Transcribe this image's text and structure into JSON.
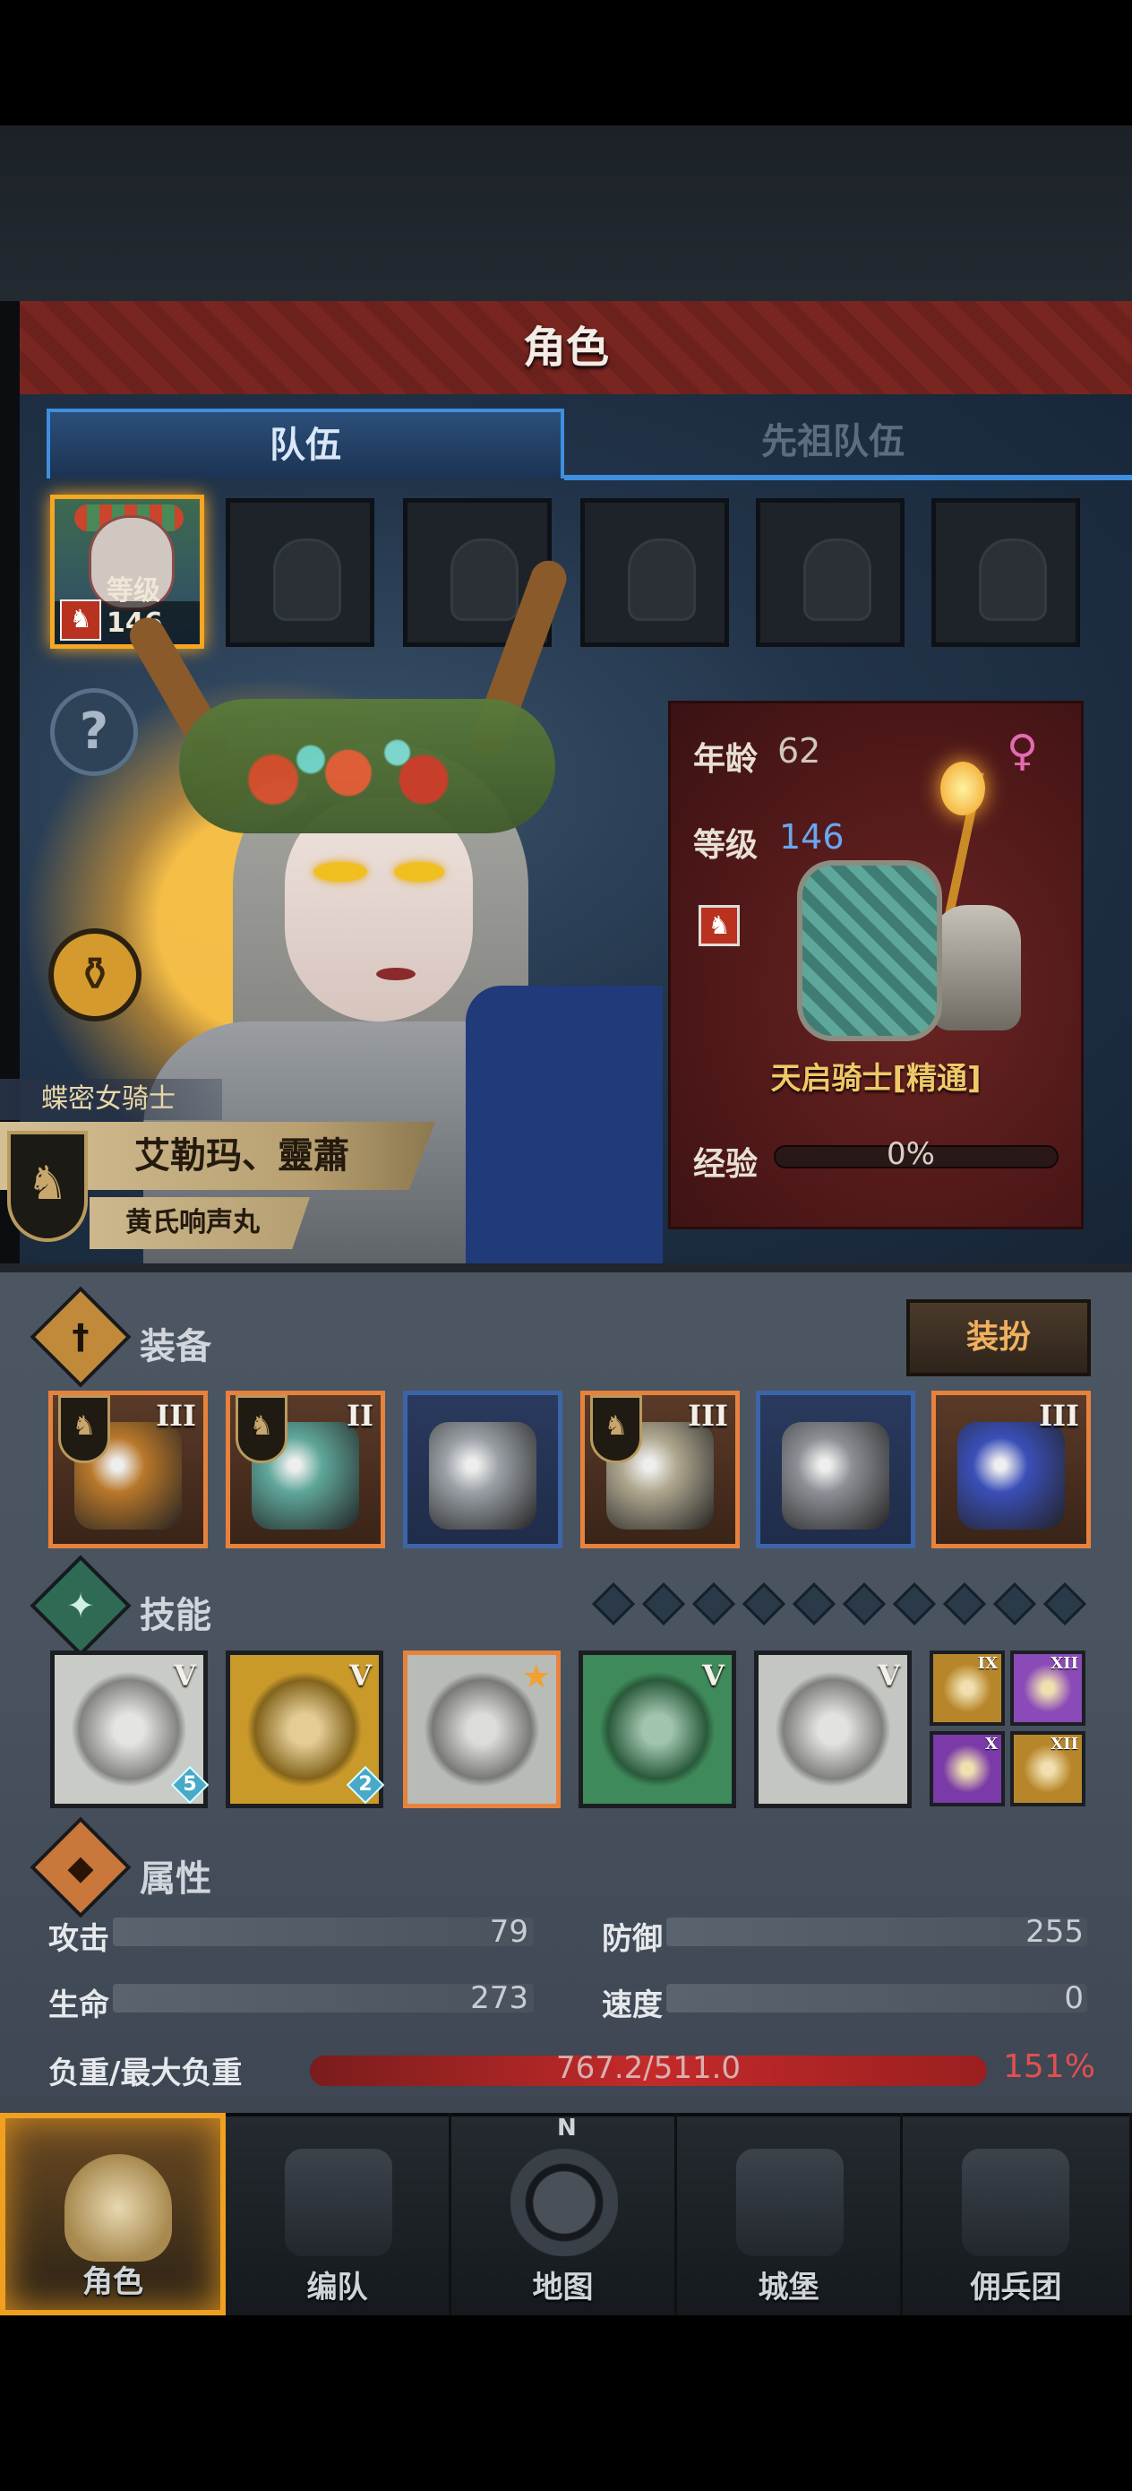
{
  "header": {
    "title": "角色"
  },
  "tabs": [
    {
      "label": "队伍",
      "active": true
    },
    {
      "label": "先祖队伍",
      "active": false
    }
  ],
  "party_slot": {
    "level_text": "等级146",
    "class_symbol": "♞"
  },
  "help_symbol": "?",
  "potion_symbol": "⚱",
  "character": {
    "class_title": "蝶密女骑士",
    "name": "艾勒玛、靈蕭",
    "epithet": "黄氏响声丸",
    "faction_symbol": "♞"
  },
  "info": {
    "age_label": "年龄",
    "age_value": "62",
    "gender_symbol": "♀",
    "level_label": "等级",
    "level_value": "146",
    "mount_class_symbol": "♞",
    "unit_name": "天启骑士[精通]",
    "exp_label": "经验",
    "exp_value": "0%",
    "exp_fraction": 0
  },
  "equipment": {
    "section_symbol": "†",
    "label": "装备",
    "dress_button": "装扮",
    "items": [
      {
        "tier": "III",
        "faction": "♞",
        "icon": "staff-icon",
        "color": "#b8772a"
      },
      {
        "tier": "II",
        "faction": "♞",
        "icon": "shield-icon",
        "color": "#5fa79a"
      },
      {
        "tier": "",
        "faction": "",
        "icon": "helmet-icon",
        "color": "#9aa0a6"
      },
      {
        "tier": "III",
        "faction": "♞",
        "icon": "armor-icon",
        "color": "#b0a890"
      },
      {
        "tier": "",
        "faction": "",
        "icon": "boots-icon",
        "color": "#8c9096"
      },
      {
        "tier": "III",
        "faction": "",
        "icon": "orb-icon",
        "color": "#3a4fb8"
      }
    ]
  },
  "skills": {
    "section_symbol": "✦",
    "label": "技能",
    "items": [
      {
        "tier": "V",
        "badge": "5",
        "icon": "sword-light-icon",
        "bg": "#c9cbc6"
      },
      {
        "tier": "V",
        "badge": "2",
        "icon": "strike-icon",
        "bg": "#c99a2a"
      },
      {
        "tier": "",
        "badge": "",
        "icon": "crystal-wing-icon",
        "bg": "#b9bbb6"
      },
      {
        "tier": "V",
        "badge": "",
        "icon": "target-icon",
        "bg": "#3f8a5a"
      },
      {
        "tier": "V",
        "badge": "",
        "icon": "crystal-hand-icon",
        "bg": "#c4c6c1"
      }
    ],
    "mini": [
      {
        "tier": "IX",
        "icon": "mini-gold-skill-icon",
        "bg": "#b8862a"
      },
      {
        "tier": "XII",
        "icon": "mini-purple-staff-icon",
        "bg": "#8a4ab8"
      },
      {
        "tier": "X",
        "icon": "mini-purple-target-icon",
        "bg": "#7a3aa8"
      },
      {
        "tier": "XII",
        "icon": "mini-gold-gem-icon",
        "bg": "#b8862a"
      }
    ]
  },
  "attributes": {
    "section_symbol": "◆",
    "label": "属性",
    "attack_label": "攻击",
    "attack_value": "79",
    "defense_label": "防御",
    "defense_value": "255",
    "hp_label": "生命",
    "hp_value": "273",
    "speed_label": "速度",
    "speed_value": "0",
    "load_label": "负重/最大负重",
    "load_value": "767.2/511.0",
    "load_percent": "151%",
    "load_fraction": 1.0
  },
  "nav": [
    {
      "label": "角色",
      "icon": "knight-icon",
      "active": true
    },
    {
      "label": "编队",
      "icon": "helmet-nav-icon",
      "active": false
    },
    {
      "label": "地图",
      "icon": "compass-icon",
      "active": false
    },
    {
      "label": "城堡",
      "icon": "castle-icon",
      "active": false
    },
    {
      "label": "佣兵团",
      "icon": "mercenary-icon",
      "active": false
    }
  ],
  "compass_north": "N"
}
